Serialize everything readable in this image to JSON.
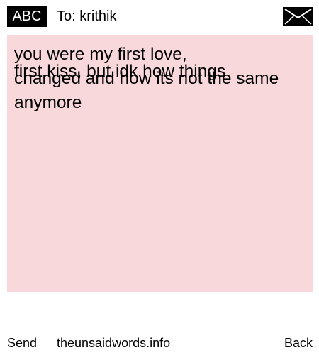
{
  "header": {
    "mode_badge": "ABC",
    "recipient": "To: krithik",
    "icon": "envelope-icon"
  },
  "message": {
    "lines": [
      "you were my first love,",
      "first kiss, but idk how things",
      "changed and how its not the same",
      "anymore"
    ],
    "background_color": "#f9d8dc"
  },
  "footer": {
    "send_label": "Send",
    "site_label": "theunsaidwords.info",
    "back_label": "Back"
  }
}
